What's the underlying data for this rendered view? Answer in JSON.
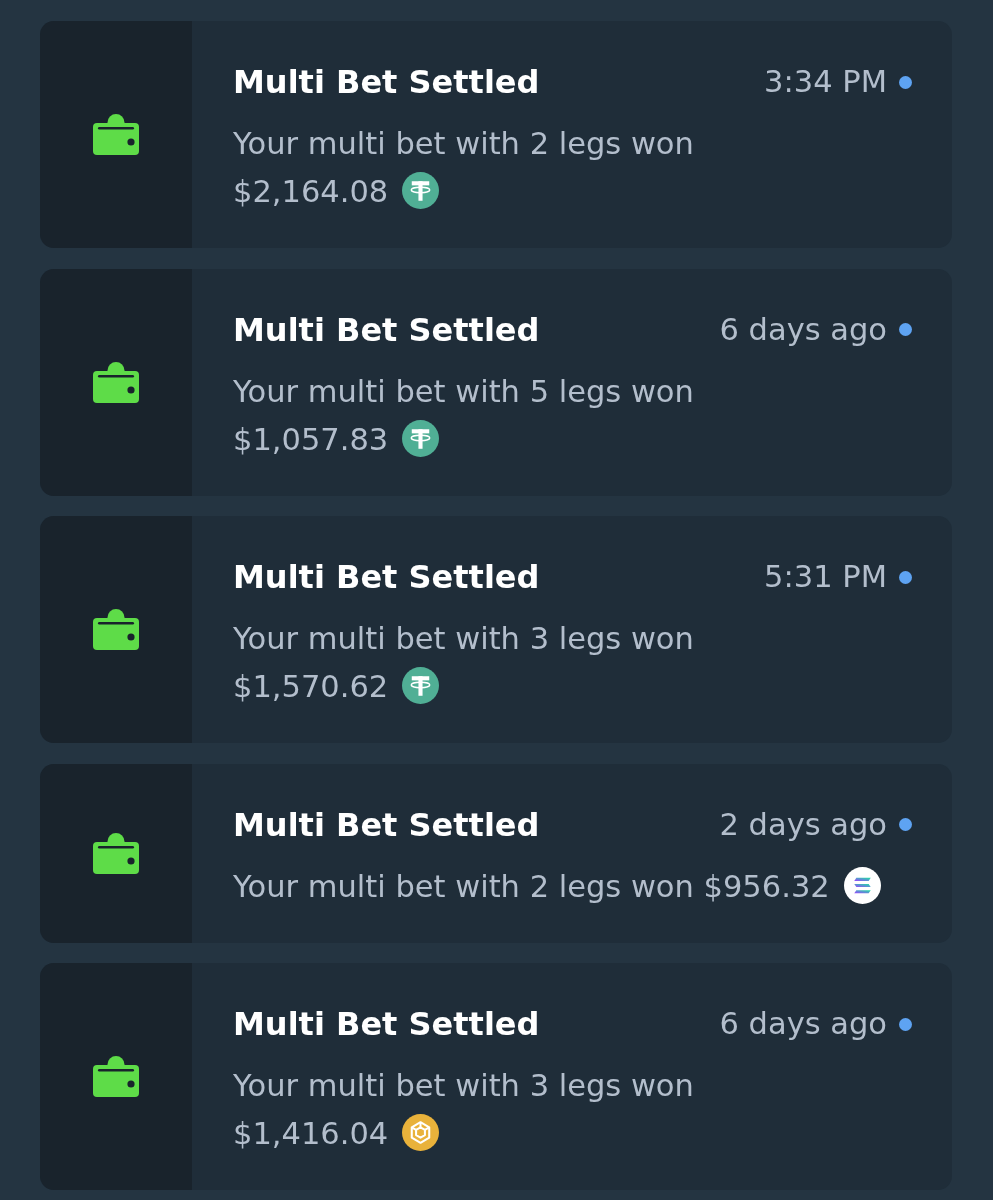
{
  "notifications": [
    {
      "title": "Multi Bet Settled",
      "time": "3:34 PM",
      "unread": true,
      "message": "Your multi bet with 2 legs won",
      "amount": "$2,164.08",
      "coin": {
        "kind": "tee"
      }
    },
    {
      "title": "Multi Bet Settled",
      "time": "6 days ago",
      "unread": true,
      "message": "Your multi bet with 5 legs won",
      "amount": "$1,057.83",
      "coin": {
        "kind": "tee"
      }
    },
    {
      "title": "Multi Bet Settled",
      "time": "5:31 PM",
      "unread": true,
      "message": "Your multi bet with 3 legs won",
      "amount": "$1,570.62",
      "coin": {
        "kind": "tee"
      }
    },
    {
      "title": "Multi Bet Settled",
      "time": "2 days ago",
      "unread": true,
      "message": "Your multi bet with 2 legs won",
      "amount": "$956.32",
      "coin": {
        "kind": "stripes"
      }
    },
    {
      "title": "Multi Bet Settled",
      "time": "6 days ago",
      "unread": true,
      "message": "Your multi bet with 3 legs won",
      "amount": "$1,416.04",
      "coin": {
        "kind": "cube"
      }
    }
  ]
}
